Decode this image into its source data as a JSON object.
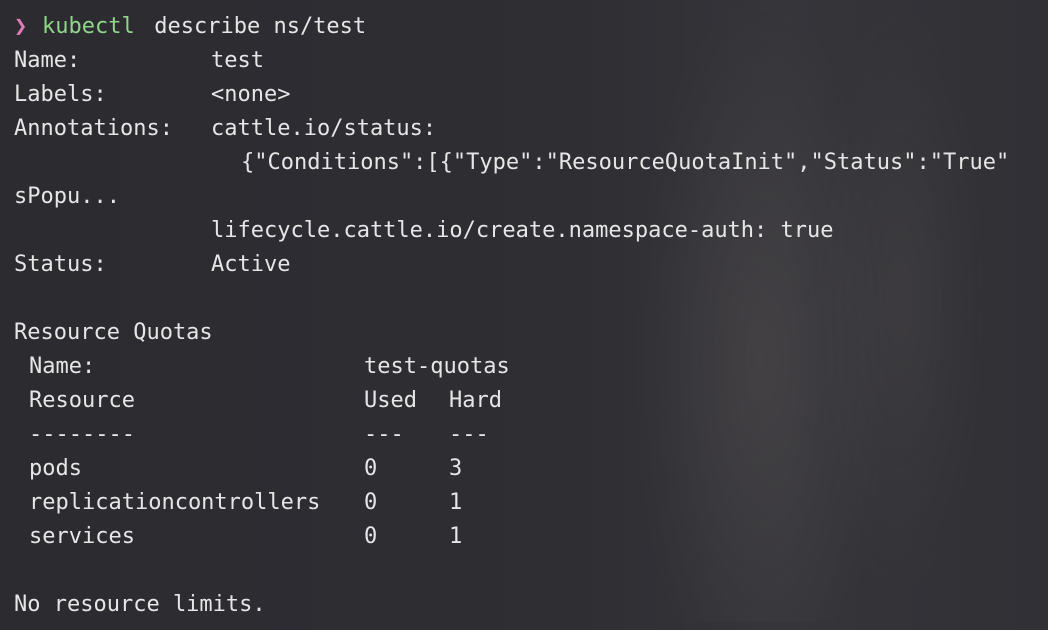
{
  "terminal": {
    "prompt_symbol": "❯",
    "command_name": "kubectl",
    "command_args": " describe ns/test",
    "describe": {
      "name_label": "Name:",
      "name_value": "test",
      "labels_label": "Labels:",
      "labels_value": "<none>",
      "annotations_label": "Annotations:",
      "annotation_1_key": "cattle.io/status:",
      "annotation_1_value": "{\"Conditions\":[{\"Type\":\"ResourceQuotaInit\",\"Status\":\"True\"",
      "annotation_1_wrap": "sPopu...",
      "annotation_2": "lifecycle.cattle.io/create.namespace-auth: true",
      "status_label": "Status:",
      "status_value": "Active"
    },
    "quotas": {
      "heading": "Resource Quotas",
      "name_label": "Name:",
      "name_value": "test-quotas",
      "columns": [
        "Resource",
        "Used",
        "Hard"
      ],
      "separators": [
        "--------",
        "---",
        "---"
      ],
      "rows": [
        {
          "resource": "pods",
          "used": "0",
          "hard": "3"
        },
        {
          "resource": "replicationcontrollers",
          "used": "0",
          "hard": "1"
        },
        {
          "resource": "services",
          "used": "0",
          "hard": "1"
        }
      ]
    },
    "limits_text": "No resource limits."
  }
}
